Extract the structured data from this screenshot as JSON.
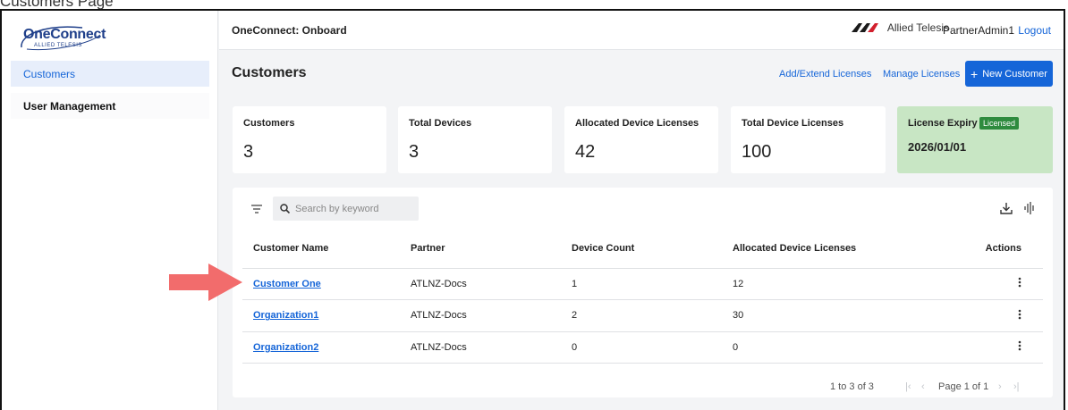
{
  "caption": "Customers Page",
  "sidebar": {
    "logo_text": "OneConnect",
    "logo_sub": "ALLIED TELESIS",
    "items": [
      {
        "label": "Customers"
      },
      {
        "label": "User Management"
      }
    ]
  },
  "header": {
    "title": "OneConnect: Onboard",
    "brand": "Allied Telesis",
    "user": "PartnerAdmin1",
    "logout": "Logout"
  },
  "page": {
    "title": "Customers",
    "add_extend": "Add/Extend Licenses",
    "manage": "Manage Licenses",
    "new_customer": "New Customer"
  },
  "stats": [
    {
      "label": "Customers",
      "value": "3"
    },
    {
      "label": "Total Devices",
      "value": "3"
    },
    {
      "label": "Allocated Device Licenses",
      "value": "42"
    },
    {
      "label": "Total Device Licenses",
      "value": "100"
    },
    {
      "label": "License Expiry",
      "value": "2026/01/01",
      "badge": "Licensed"
    }
  ],
  "search": {
    "placeholder": "Search by keyword"
  },
  "table": {
    "columns": [
      "Customer Name",
      "Partner",
      "Device Count",
      "Allocated Device Licenses",
      "Actions"
    ],
    "rows": [
      {
        "name": "Customer One",
        "partner": "ATLNZ-Docs",
        "devices": "1",
        "licenses": "12"
      },
      {
        "name": "Organization1",
        "partner": "ATLNZ-Docs",
        "devices": "2",
        "licenses": "30"
      },
      {
        "name": "Organization2",
        "partner": "ATLNZ-Docs",
        "devices": "0",
        "licenses": "0"
      }
    ]
  },
  "pagination": {
    "range": "1 to 3 of 3",
    "page": "Page 1 of 1"
  },
  "colors": {
    "accent": "#1565d8",
    "license_card": "#c8e6c4",
    "badge": "#2e8b3e",
    "arrow": "#f26c6c"
  }
}
